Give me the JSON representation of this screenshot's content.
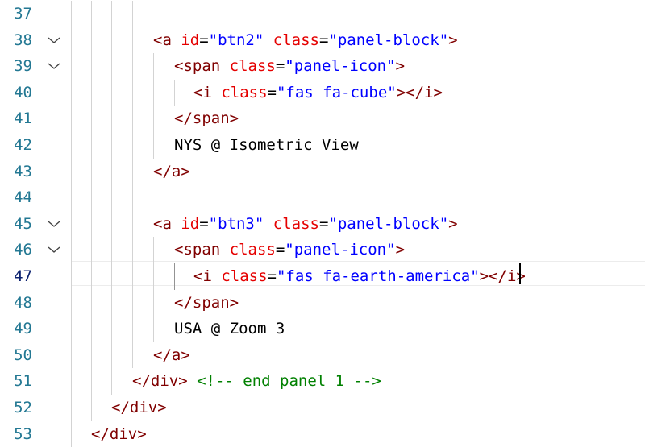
{
  "editor": {
    "lines": [
      {
        "num": "37",
        "fold": false,
        "indent": 0,
        "tokens": []
      },
      {
        "num": "38",
        "fold": true,
        "indent": 190,
        "tokens": [
          {
            "t": "tag",
            "v": "<a "
          },
          {
            "t": "attr",
            "v": "id"
          },
          {
            "t": "eq",
            "v": "="
          },
          {
            "t": "str",
            "v": "\"btn2\""
          },
          {
            "t": "tag",
            "v": " "
          },
          {
            "t": "attr",
            "v": "class"
          },
          {
            "t": "eq",
            "v": "="
          },
          {
            "t": "str",
            "v": "\"panel-block\""
          },
          {
            "t": "tag",
            "v": ">"
          }
        ]
      },
      {
        "num": "39",
        "fold": true,
        "indent": 216,
        "tokens": [
          {
            "t": "tag",
            "v": "<span "
          },
          {
            "t": "attr",
            "v": "class"
          },
          {
            "t": "eq",
            "v": "="
          },
          {
            "t": "str",
            "v": "\"panel-icon\""
          },
          {
            "t": "tag",
            "v": ">"
          }
        ]
      },
      {
        "num": "40",
        "fold": false,
        "indent": 240,
        "tokens": [
          {
            "t": "tag",
            "v": "<i "
          },
          {
            "t": "attr",
            "v": "class"
          },
          {
            "t": "eq",
            "v": "="
          },
          {
            "t": "str",
            "v": "\"fas fa-cube\""
          },
          {
            "t": "tag",
            "v": "></i>"
          }
        ]
      },
      {
        "num": "41",
        "fold": false,
        "indent": 216,
        "tokens": [
          {
            "t": "tag",
            "v": "</span>"
          }
        ]
      },
      {
        "num": "42",
        "fold": false,
        "indent": 216,
        "tokens": [
          {
            "t": "txt",
            "v": "NYS @ Isometric View"
          }
        ]
      },
      {
        "num": "43",
        "fold": false,
        "indent": 190,
        "tokens": [
          {
            "t": "tag",
            "v": "</a>"
          }
        ]
      },
      {
        "num": "44",
        "fold": false,
        "indent": 0,
        "tokens": []
      },
      {
        "num": "45",
        "fold": true,
        "indent": 190,
        "tokens": [
          {
            "t": "tag",
            "v": "<a "
          },
          {
            "t": "attr",
            "v": "id"
          },
          {
            "t": "eq",
            "v": "="
          },
          {
            "t": "str",
            "v": "\"btn3\""
          },
          {
            "t": "tag",
            "v": " "
          },
          {
            "t": "attr",
            "v": "class"
          },
          {
            "t": "eq",
            "v": "="
          },
          {
            "t": "str",
            "v": "\"panel-block\""
          },
          {
            "t": "tag",
            "v": ">"
          }
        ]
      },
      {
        "num": "46",
        "fold": true,
        "indent": 216,
        "tokens": [
          {
            "t": "tag",
            "v": "<span "
          },
          {
            "t": "attr",
            "v": "class"
          },
          {
            "t": "eq",
            "v": "="
          },
          {
            "t": "str",
            "v": "\"panel-icon\""
          },
          {
            "t": "tag",
            "v": ">"
          }
        ]
      },
      {
        "num": "47",
        "fold": false,
        "indent": 240,
        "active": true,
        "tokens": [
          {
            "t": "tag",
            "v": "<i "
          },
          {
            "t": "attr",
            "v": "class"
          },
          {
            "t": "eq",
            "v": "="
          },
          {
            "t": "str",
            "v": "\"fas fa-earth-america\""
          },
          {
            "t": "tag",
            "v": "></i>"
          }
        ]
      },
      {
        "num": "48",
        "fold": false,
        "indent": 216,
        "tokens": [
          {
            "t": "tag",
            "v": "</span>"
          }
        ]
      },
      {
        "num": "49",
        "fold": false,
        "indent": 216,
        "tokens": [
          {
            "t": "txt",
            "v": "USA @ Zoom 3"
          }
        ]
      },
      {
        "num": "50",
        "fold": false,
        "indent": 190,
        "tokens": [
          {
            "t": "tag",
            "v": "</a>"
          }
        ]
      },
      {
        "num": "51",
        "fold": false,
        "indent": 164,
        "tokens": [
          {
            "t": "tag",
            "v": "</div>"
          },
          {
            "t": "txt",
            "v": " "
          },
          {
            "t": "cmt",
            "v": "<!-- end panel 1 -->"
          }
        ]
      },
      {
        "num": "52",
        "fold": false,
        "indent": 138,
        "tokens": [
          {
            "t": "tag",
            "v": "</div>"
          }
        ]
      },
      {
        "num": "53",
        "fold": false,
        "indent": 113,
        "tokens": [
          {
            "t": "tag",
            "v": "</div>"
          }
        ]
      }
    ]
  },
  "colors": {
    "tag": "#800000",
    "attribute": "#e50000",
    "string": "#0000ff",
    "comment": "#008000",
    "line_number": "#237893"
  }
}
